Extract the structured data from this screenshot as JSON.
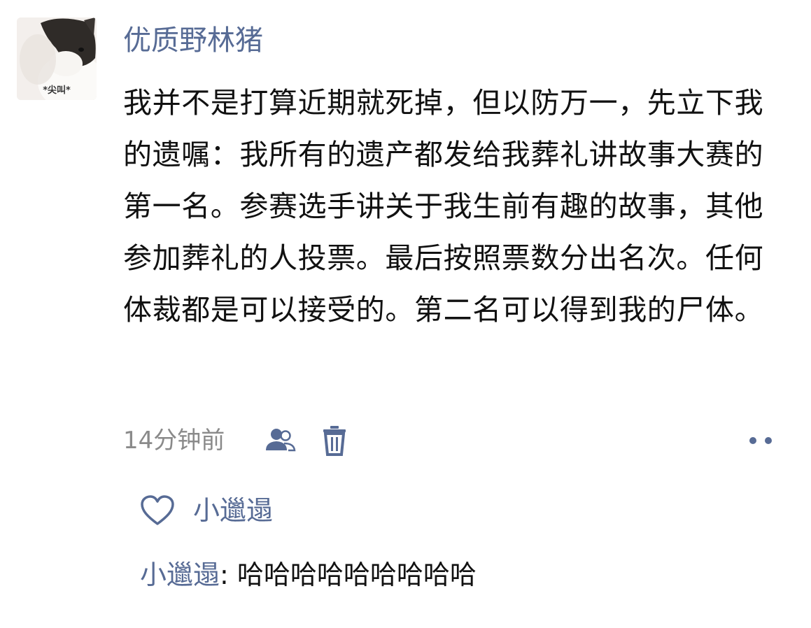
{
  "post": {
    "avatar": {
      "caption": "*尖叫*"
    },
    "author": "优质野林猪",
    "content": "我并不是打算近期就死掉，但以防万一，先立下我的遗嘱：我所有的遗产都发给我葬礼讲故事大赛的第一名。参赛选手讲关于我生前有趣的故事，其他参加葬礼的人投票。最后按照票数分出名次。任何体裁都是可以接受的。第二名可以得到我的尸体。",
    "timestamp": "14分钟前",
    "icons": {
      "visibility": "friends-icon",
      "delete": "trash-icon",
      "more": "more-dots-icon",
      "like": "heart-icon"
    }
  },
  "likes": {
    "names": "小邋遢"
  },
  "comments": [
    {
      "author": "小邋遢",
      "separator": ": ",
      "text": "哈哈哈哈哈哈哈哈哈"
    }
  ],
  "colors": {
    "link": "#576b95",
    "text": "#111111",
    "meta": "#8a8a8a"
  }
}
